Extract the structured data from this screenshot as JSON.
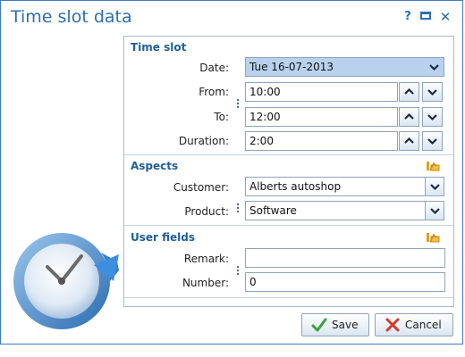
{
  "window": {
    "title": "Time slot data"
  },
  "title_buttons": {
    "help": "?",
    "close": "✕"
  },
  "sections": {
    "time_slot": {
      "title": "Time slot",
      "date_label": "Date:",
      "date_value": "Tue 16-07-2013",
      "from_label": "From:",
      "from_value": "10:00",
      "to_label": "To:",
      "to_value": "12:00",
      "duration_label": "Duration:",
      "duration_value": "2:00"
    },
    "aspects": {
      "title": "Aspects",
      "customer_label": "Customer:",
      "customer_value": "Alberts autoshop",
      "product_label": "Product:",
      "product_value": "Software"
    },
    "user_fields": {
      "title": "User fields",
      "remark_label": "Remark:",
      "remark_value": "",
      "number_label": "Number:",
      "number_value": "0"
    }
  },
  "buttons": {
    "save": "Save",
    "cancel": "Cancel"
  },
  "colors": {
    "accent": "#2d6eb3",
    "section_title": "#1f5f9a",
    "selected_field": "#b8d2ee",
    "border": "#8ea4bd"
  },
  "icons": [
    "help-icon",
    "maximize-icon",
    "close-icon",
    "chevron-down-icon",
    "chevron-up-icon",
    "clock-refresh-icon",
    "edit-fields-icon",
    "checkmark-icon",
    "cross-icon"
  ]
}
